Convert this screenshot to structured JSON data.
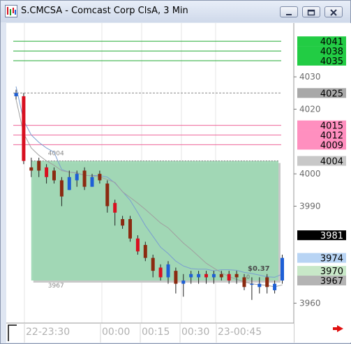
{
  "window": {
    "title": "S.CMCSA - Comcast Corp ClsA, 3 Min",
    "buttons": [
      "minimize-button",
      "maximize-button",
      "close-button"
    ]
  },
  "chart_data": {
    "type": "candlestick",
    "y_axis": {
      "range": [
        3956,
        4046
      ],
      "ticks": [
        "4030",
        "4020",
        "4000",
        "3990",
        "3960"
      ]
    },
    "x_axis": {
      "tick_labels": [
        "22-23:30",
        "00:00",
        "00:15",
        "00:30",
        "23-00:45"
      ]
    },
    "price_tags": [
      {
        "label": "4041",
        "color": "#22cc44",
        "text_color": "#000000",
        "value": 4041
      },
      {
        "label": "4038",
        "color": "#22cc44",
        "text_color": "#000000",
        "value": 4038
      },
      {
        "label": "4035",
        "color": "#22cc44",
        "text_color": "#000000",
        "value": 4035
      },
      {
        "label": "4025",
        "color": "#a8a8a8",
        "text_color": "#000000",
        "value": 4025
      },
      {
        "label": "4015",
        "color": "#ff8fbf",
        "text_color": "#000000",
        "value": 4015
      },
      {
        "label": "4012",
        "color": "#ff8fbf",
        "text_color": "#000000",
        "value": 4012
      },
      {
        "label": "4009",
        "color": "#ff8fbf",
        "text_color": "#000000",
        "value": 4009
      },
      {
        "label": "4004",
        "color": "#c8c8c8",
        "text_color": "#000000",
        "value": 4004
      },
      {
        "label": "3981",
        "color": "#000000",
        "text_color": "#ffffff",
        "value": 3981
      },
      {
        "label": "3974",
        "color": "#b8d4f4",
        "text_color": "#000000",
        "value": 3974
      },
      {
        "label": "3970",
        "color": "#c8e8c8",
        "text_color": "#000000",
        "value": 3970
      },
      {
        "label": "3967",
        "color": "#b4b4b4",
        "text_color": "#000000",
        "value": 3967
      }
    ],
    "horizontal_lines": [
      {
        "value": 4041,
        "color": "#22aa33"
      },
      {
        "value": 4038,
        "color": "#22aa33"
      },
      {
        "value": 4035,
        "color": "#22aa33"
      },
      {
        "value": 4025,
        "color": "#888888"
      },
      {
        "value": 4015,
        "color": "#ee6699"
      },
      {
        "value": 4012,
        "color": "#ee6699"
      },
      {
        "value": 4009,
        "color": "#ee6699"
      }
    ],
    "range_box": {
      "high": 4004,
      "low": 3967,
      "high_label": "4004",
      "low_label": "3967",
      "color": "#9fd8b4"
    },
    "box_annotation": "$0.37",
    "box_annotation_sub": "0",
    "candles": [
      {
        "o": 4024,
        "h": 4026,
        "l": 4023,
        "c": 4025
      },
      {
        "o": 4024,
        "h": 4025,
        "l": 4003,
        "c": 4004
      },
      {
        "o": 4002,
        "h": 4005,
        "l": 3999,
        "c": 4001
      },
      {
        "o": 4004,
        "h": 4005,
        "l": 3999,
        "c": 4001
      },
      {
        "o": 4002,
        "h": 4003,
        "l": 3997,
        "c": 3999
      },
      {
        "o": 4001,
        "h": 4002,
        "l": 3997,
        "c": 3998
      },
      {
        "o": 3998,
        "h": 3999,
        "l": 3990,
        "c": 3993
      },
      {
        "o": 3995,
        "h": 4001,
        "l": 3995,
        "c": 3999
      },
      {
        "o": 3998,
        "h": 4001,
        "l": 3996,
        "c": 4000
      },
      {
        "o": 4001,
        "h": 4002,
        "l": 3995,
        "c": 3996
      },
      {
        "o": 3996,
        "h": 4000,
        "l": 3996,
        "c": 3999
      },
      {
        "o": 4000,
        "h": 4001,
        "l": 3997,
        "c": 3998
      },
      {
        "o": 3997,
        "h": 3998,
        "l": 3988,
        "c": 3990
      },
      {
        "o": 3991,
        "h": 3992,
        "l": 3984,
        "c": 3988
      },
      {
        "o": 3986,
        "h": 3987,
        "l": 3983,
        "c": 3984
      },
      {
        "o": 3986,
        "h": 3987,
        "l": 3979,
        "c": 3980
      },
      {
        "o": 3980,
        "h": 3981,
        "l": 3975,
        "c": 3976
      },
      {
        "o": 3978,
        "h": 3979,
        "l": 3973,
        "c": 3974
      },
      {
        "o": 3974,
        "h": 3975,
        "l": 3968,
        "c": 3970
      },
      {
        "o": 3971,
        "h": 3972,
        "l": 3967,
        "c": 3968
      },
      {
        "o": 3968,
        "h": 3973,
        "l": 3966,
        "c": 3972
      },
      {
        "o": 3970,
        "h": 3971,
        "l": 3963,
        "c": 3966
      },
      {
        "o": 3966,
        "h": 3969,
        "l": 3962,
        "c": 3967
      },
      {
        "o": 3968,
        "h": 3970,
        "l": 3966,
        "c": 3969
      },
      {
        "o": 3968,
        "h": 3970,
        "l": 3966,
        "c": 3969
      },
      {
        "o": 3969,
        "h": 3970,
        "l": 3966,
        "c": 3968
      },
      {
        "o": 3968,
        "h": 3970,
        "l": 3966,
        "c": 3969
      },
      {
        "o": 3969,
        "h": 3970,
        "l": 3967,
        "c": 3968
      },
      {
        "o": 3969,
        "h": 3970,
        "l": 3966,
        "c": 3967
      },
      {
        "o": 3969,
        "h": 3970,
        "l": 3966,
        "c": 3968
      },
      {
        "o": 3968,
        "h": 3969,
        "l": 3964,
        "c": 3965
      },
      {
        "o": 3966,
        "h": 3968,
        "l": 3961,
        "c": 3966
      },
      {
        "o": 3965,
        "h": 3968,
        "l": 3963,
        "c": 3966
      },
      {
        "o": 3968,
        "h": 3969,
        "l": 3963,
        "c": 3965
      },
      {
        "o": 3964,
        "h": 3967,
        "l": 3963,
        "c": 3966
      },
      {
        "o": 3967,
        "h": 3975,
        "l": 3966,
        "c": 3974
      }
    ],
    "colors": {
      "up": "#1e5fd6",
      "down": "#d81020",
      "down_alt": "#8b2a10",
      "upper_band": "#7a9ed0",
      "lower_band": "#a0a0a0"
    }
  }
}
